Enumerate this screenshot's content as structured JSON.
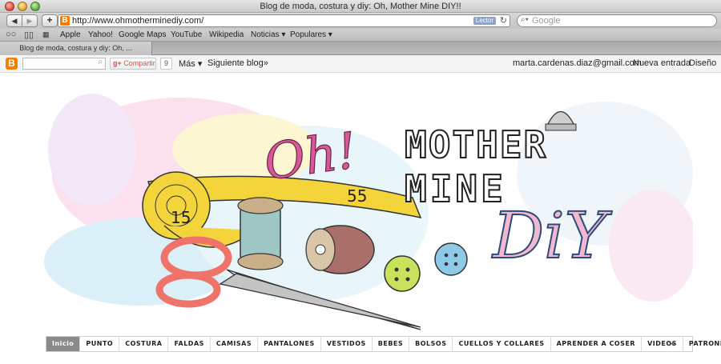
{
  "window": {
    "title": "Blog de moda, costura y diy: Oh, Mother Mine DIY!!"
  },
  "toolbar": {
    "back_icon": "◀",
    "forward_icon": "▶",
    "add_icon": "+",
    "url": "http://www.ohmotherminediy.com/",
    "reader_label": "Lector",
    "reload_icon": "↻",
    "search_placeholder": "Google"
  },
  "bookmarks": [
    "Apple",
    "Yahoo!",
    "Google Maps",
    "YouTube",
    "Wikipedia",
    "Noticias ▾",
    "Populares ▾"
  ],
  "tab": {
    "label": "Blog de moda, costura y diy: Oh, ..."
  },
  "blogger_bar": {
    "logo": "B",
    "share_label": "Compartir",
    "share_count": "9",
    "more_label": "Más ▾",
    "next_blog_label": "Siguiente blog»",
    "email": "marta.cardenas.diaz@gmail.com",
    "new_post_label": "Nueva entrada",
    "design_label": "Diseño"
  },
  "header": {
    "oh": "Oh!",
    "line1": "MOTHER",
    "line2": "MINE",
    "diy": "DiY",
    "tape_left": "15",
    "tape_right": "55"
  },
  "menu": [
    "Inicio",
    "PUNTO",
    "COSTURA",
    "FALDAS",
    "CAMISAS",
    "PANTALONES",
    "VESTIDOS",
    "BEBES",
    "BOLSOS",
    "CUELLOS Y COLLARES",
    "APRENDER A COSER",
    "VIDEOS",
    "PATRONES"
  ],
  "colors": {
    "blogger_orange": "#f57d00",
    "oh_pink": "#d9589a",
    "tape_yellow": "#f3d43a",
    "scissors_coral": "#f0736a",
    "button_green": "#c6e35b",
    "button_blue": "#8ec9e8"
  }
}
